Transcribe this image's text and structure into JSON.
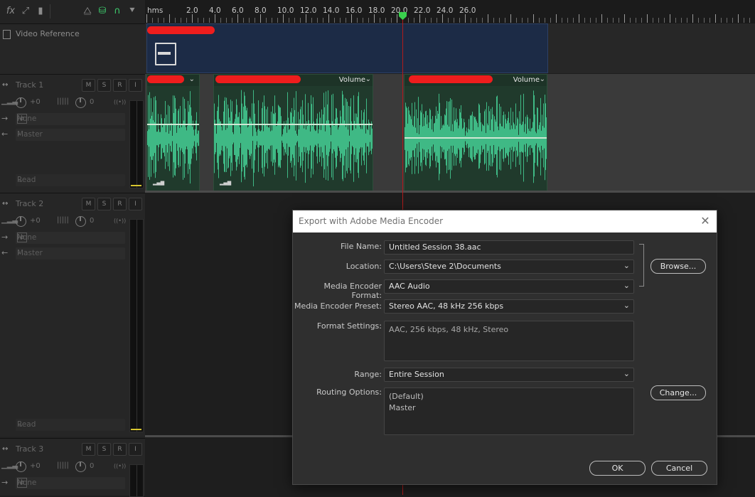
{
  "toolbar": {
    "tools": [
      {
        "icon": "fx-icon",
        "glyph": "fx"
      },
      {
        "icon": "envelope-icon",
        "glyph": "⤢"
      },
      {
        "icon": "levels-icon",
        "glyph": "▮"
      },
      {
        "icon": "metronome-icon",
        "glyph": "⧋"
      },
      {
        "icon": "snap-icon",
        "glyph": "⛁"
      },
      {
        "icon": "magnet-icon",
        "glyph": "∩"
      },
      {
        "icon": "pin-icon",
        "glyph": "⯆"
      }
    ]
  },
  "ruler": {
    "origin_label": "hms",
    "labels": [
      "2.0",
      "4.0",
      "6.0",
      "8.0",
      "10.0",
      "12.0",
      "14.0",
      "16.0",
      "18.0",
      "20.0",
      "22.0",
      "24.0",
      "26.0"
    ]
  },
  "video_track": {
    "name": "Video Reference"
  },
  "tracks": [
    {
      "name": "Track 1",
      "mute": "M",
      "solo": "S",
      "record": "R",
      "input_mon": "I",
      "volume": "+0",
      "pan": "0",
      "input": "None",
      "output": "Master",
      "automation": "Read"
    },
    {
      "name": "Track 2",
      "mute": "M",
      "solo": "S",
      "record": "R",
      "input_mon": "I",
      "volume": "+0",
      "pan": "0",
      "input": "None",
      "output": "Master",
      "automation": "Read"
    },
    {
      "name": "Track 3",
      "mute": "M",
      "solo": "S",
      "record": "R",
      "input_mon": "I",
      "volume": "+0",
      "pan": "0",
      "input": "None"
    }
  ],
  "clips": {
    "volume_label": "Volume"
  },
  "dialog": {
    "title": "Export with Adobe Media Encoder",
    "close_glyph": "✕",
    "file_name_label": "File Name:",
    "file_name_value": "Untitled Session 38.aac",
    "location_label": "Location:",
    "location_value": "C:\\Users\\Steve 2\\Documents",
    "format_label": "Media Encoder Format:",
    "format_value": "AAC Audio",
    "preset_label": "Media Encoder Preset:",
    "preset_value": "Stereo AAC, 48 kHz 256 kbps",
    "format_settings_label": "Format Settings:",
    "format_settings_value": "AAC, 256 kbps, 48 kHz, Stereo",
    "range_label": "Range:",
    "range_value": "Entire Session",
    "routing_label": "Routing Options:",
    "routing_line1": "(Default)",
    "routing_line2": "Master",
    "browse_label": "Browse...",
    "change_label": "Change...",
    "ok_label": "OK",
    "cancel_label": "Cancel"
  },
  "colors": {
    "clip_green": "#203a2c",
    "waveform": "#3fb985",
    "video_clip": "#1c2b46",
    "playhead": "#b11b1b",
    "playhead_cap": "#3ad04d"
  }
}
